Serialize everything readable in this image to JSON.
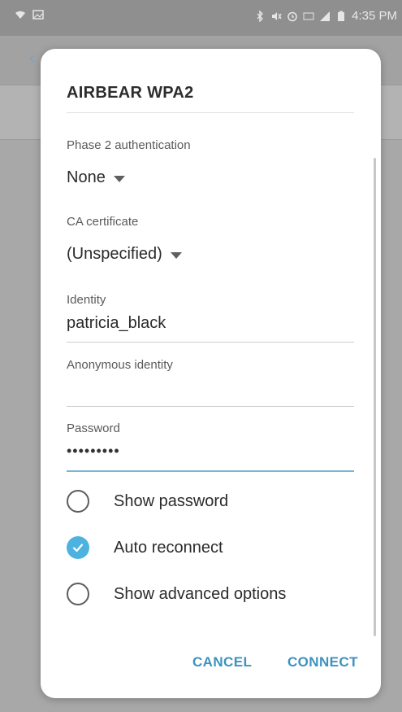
{
  "status_bar": {
    "time": "4:35 PM"
  },
  "dialog": {
    "title": "AIRBEAR WPA2",
    "phase2": {
      "label": "Phase 2 authentication",
      "value": "None"
    },
    "ca_cert": {
      "label": "CA certificate",
      "value": "(Unspecified)"
    },
    "identity": {
      "label": "Identity",
      "value": "patricia_black"
    },
    "anonymous_identity": {
      "label": "Anonymous identity",
      "value": ""
    },
    "password": {
      "label": "Password",
      "value": "•••••••••"
    },
    "options": {
      "show_password": {
        "label": "Show password",
        "checked": false
      },
      "auto_reconnect": {
        "label": "Auto reconnect",
        "checked": true
      },
      "show_advanced": {
        "label": "Show advanced options",
        "checked": false
      }
    },
    "buttons": {
      "cancel": "CANCEL",
      "connect": "CONNECT"
    }
  },
  "colors": {
    "accent": "#4db2e0",
    "button_text": "#3e92bd",
    "active_underline": "#7ab3d6"
  }
}
